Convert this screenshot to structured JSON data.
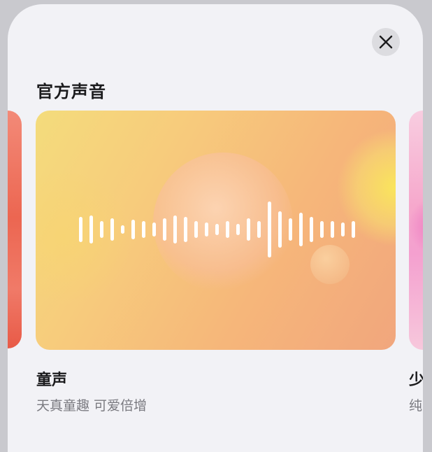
{
  "dialog": {
    "close_icon": "close-icon"
  },
  "section": {
    "title": "官方声音"
  },
  "voices": [
    {
      "name": "童声",
      "description": "天真童趣 可爱倍增",
      "colors": {
        "start": "#f4dc7c",
        "end": "#f1a67d"
      }
    },
    {
      "name": "少",
      "description": "纯",
      "colors": {
        "start": "#f8cde0",
        "end": "#f4a0cf"
      }
    }
  ],
  "waveform_icon": "audio-waveform-icon"
}
